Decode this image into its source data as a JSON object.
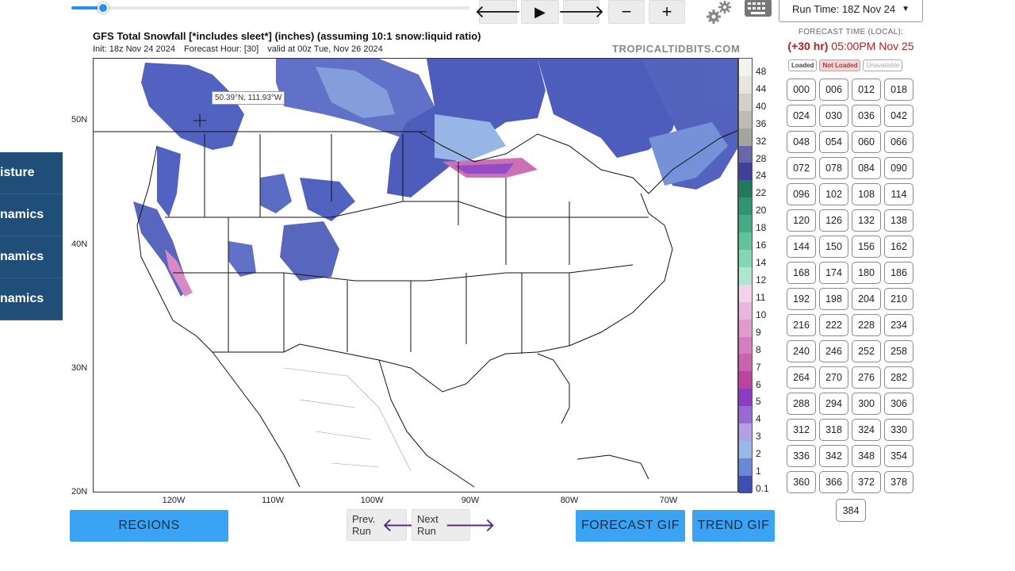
{
  "toolbar": {
    "slider_fraction": 0.08,
    "back_icon": "arrow-left",
    "play_icon": "play",
    "forward_icon": "arrow-right",
    "zoom_out": "−",
    "zoom_in": "+",
    "back_glyph": "🡐",
    "play_glyph": "▶",
    "forward_glyph": "🡒"
  },
  "run_time": {
    "label": "Run Time: 18Z Nov 24"
  },
  "forecast_time": {
    "label": "FORECAST TIME (LOCAL):",
    "offset": "(+30 hr)",
    "time": "05:00PM Nov 25"
  },
  "status_legend": {
    "loaded": "Loaded",
    "not_loaded": "Not Loaded",
    "unavailable": "Unavailable"
  },
  "hours": [
    "000",
    "006",
    "012",
    "018",
    "024",
    "030",
    "036",
    "042",
    "048",
    "054",
    "060",
    "066",
    "072",
    "078",
    "084",
    "090",
    "096",
    "102",
    "108",
    "114",
    "120",
    "126",
    "132",
    "138",
    "144",
    "150",
    "156",
    "162",
    "168",
    "174",
    "180",
    "186",
    "192",
    "198",
    "204",
    "210",
    "216",
    "222",
    "228",
    "234",
    "240",
    "246",
    "252",
    "258",
    "264",
    "270",
    "276",
    "282",
    "288",
    "294",
    "300",
    "306",
    "312",
    "318",
    "324",
    "330",
    "336",
    "342",
    "348",
    "354",
    "360",
    "366",
    "372",
    "378"
  ],
  "hour_last": "384",
  "side_menu": [
    "isture",
    "namics",
    "namics",
    "namics"
  ],
  "map": {
    "title": "GFS Total Snowfall [*includes sleet*] (inches) (assuming 10:1 snow:liquid ratio)",
    "init": "Init: 18z Nov 24 2024",
    "forecast_hour": "Forecast Hour: [30]",
    "valid": "valid at 00z Tue, Nov 26 2024",
    "watermark": "TROPICALTIDBITS.COM",
    "tooltip": "50.39°N, 111.93°W",
    "lat_labels": [
      "50N",
      "40N",
      "30N",
      "20N"
    ],
    "lon_labels": [
      "120W",
      "110W",
      "100W",
      "90W",
      "80W",
      "70W"
    ]
  },
  "colorbar": {
    "labels": [
      "48",
      "44",
      "40",
      "36",
      "32",
      "28",
      "24",
      "22",
      "20",
      "18",
      "16",
      "14",
      "12",
      "11",
      "10",
      "9",
      "8",
      "7",
      "6",
      "5",
      "4",
      "3",
      "2",
      "1",
      "0.1"
    ],
    "colors": [
      "#f4f4ee",
      "#e6e6dc",
      "#d2d2c8",
      "#bcbcb2",
      "#a4a4a0",
      "#6868a8",
      "#40409a",
      "#1f7a5e",
      "#2f9470",
      "#45aa85",
      "#62c29c",
      "#86d6b6",
      "#aee6d0",
      "#f3d3ea",
      "#eab7dc",
      "#e09ace",
      "#d67fc0",
      "#c963b0",
      "#bb44a0",
      "#8a3cc2",
      "#9a6ad4",
      "#b4a0e4",
      "#98b8e8",
      "#6a88d4",
      "#3e4fb4"
    ]
  },
  "buttons": {
    "regions": "REGIONS",
    "prev_run_1": "Prev.",
    "prev_run_2": "Run",
    "next_run_1": "Next",
    "next_run_2": "Run",
    "forecast_gif": "FORECAST GIF",
    "trend_gif": "TREND GIF",
    "arrow_left": "🡐",
    "arrow_right": "🡒"
  }
}
